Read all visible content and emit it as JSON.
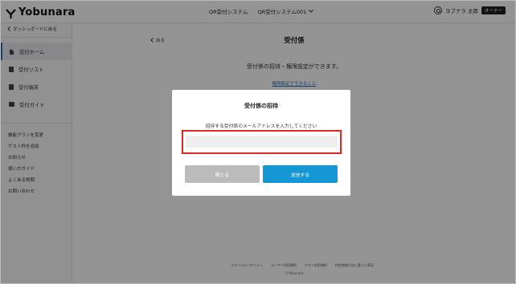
{
  "header": {
    "logo_text": "Yobunara",
    "system_name": "QR受付システム",
    "system_selector": "QR受付システム001",
    "user_name": "ヨブナラ 太郎",
    "role_badge": "オーナー"
  },
  "sidebar": {
    "back_label": "ダッシュボードに戻る",
    "nav": [
      {
        "label": "受付ホーム",
        "icon": "home-icon",
        "active": true
      },
      {
        "label": "受付リスト",
        "icon": "list-icon"
      },
      {
        "label": "受付端末",
        "icon": "terminal-icon"
      },
      {
        "label": "受付ガイド",
        "icon": "guide-icon"
      }
    ],
    "links": [
      "機能プランを変更",
      "ゲスト枠を追加",
      "お知らせ",
      "使い方ガイド",
      "よくある質問",
      "お問い合わせ"
    ]
  },
  "main": {
    "back_label": "戻る",
    "title": "受付係",
    "description": "受付係の招待・権限設定ができます。",
    "permission_link": "権限設定でできること"
  },
  "footer": {
    "links": [
      "プライバシーポリシー",
      "ユーザー利用規約",
      "ゲスト利用規約",
      "特定商取引法に基づく表記"
    ],
    "copyright": "©Yobunara"
  },
  "modal": {
    "title": "受付係の招待",
    "message": "招待する受付係のメールアドレスを入力してください",
    "email_value": "",
    "email_placeholder": "",
    "close_label": "閉じる",
    "send_label": "送信する"
  },
  "colors": {
    "accent": "#1597d3",
    "highlight_border": "#e02727",
    "overlay": "rgba(0,0,0,0.42)",
    "active_nav_bg": "#e7ebf0"
  }
}
